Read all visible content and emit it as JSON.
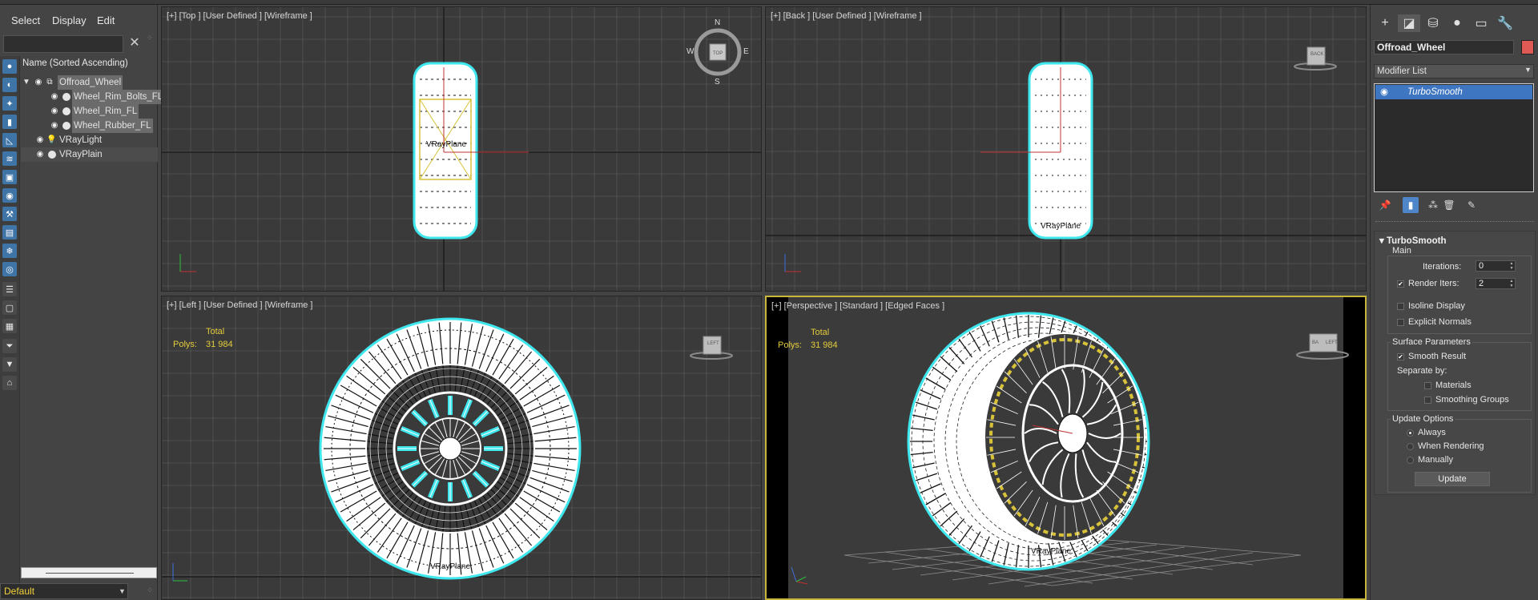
{
  "explorer": {
    "menu": [
      "Select",
      "Display",
      "Edit"
    ],
    "column_header": "Name (Sorted Ascending)",
    "objects": [
      {
        "name": "Offroad_Wheel",
        "selected": true
      },
      {
        "name": "Wheel_Rim_Bolts_FL",
        "selected": true
      },
      {
        "name": "Wheel_Rim_FL",
        "selected": true
      },
      {
        "name": "Wheel_Rubber_FL",
        "selected": true
      },
      {
        "name": "VRayLight",
        "selected": false
      },
      {
        "name": "VRayPlain",
        "selected": false
      }
    ],
    "layer": "Default"
  },
  "viewports": {
    "top": {
      "label": "[+] [Top ] [User Defined ] [Wireframe ]",
      "plane_label": "VRayPlane",
      "compass": {
        "n": "N",
        "s": "S",
        "e": "E",
        "w": "W"
      },
      "cube": "TOP"
    },
    "back": {
      "label": "[+] [Back ] [User Defined ] [Wireframe ]",
      "plane_label": "VRayPlane",
      "cube": "BACK"
    },
    "left": {
      "label": "[+] [Left ] [User Defined ] [Wireframe ]",
      "plane_label": "VRayPlane",
      "cube": "LEFT",
      "stats": {
        "total": "Total",
        "polys_label": "Polys:",
        "polys": "31 984"
      }
    },
    "perspective": {
      "label": "[+] [Perspective ] [Standard ] [Edged Faces ]",
      "plane_label": "VRayPlane",
      "cube_a": "BA",
      "cube_b": "LEFT",
      "stats": {
        "total": "Total",
        "polys_label": "Polys:",
        "polys": "31 984"
      }
    }
  },
  "command_panel": {
    "object_name": "Offroad_Wheel",
    "object_color": "#e05a55",
    "modifier_list": "Modifier List",
    "stack_item": "TurboSmooth",
    "rollout": {
      "title": "TurboSmooth",
      "main": "Main",
      "iterations_label": "Iterations:",
      "iterations": "0",
      "render_iters_label": "Render Iters:",
      "render_iters": "2",
      "isoline": "Isoline Display",
      "explicit": "Explicit Normals",
      "surface": "Surface Parameters",
      "smooth_result": "Smooth Result",
      "separate_by": "Separate by:",
      "materials": "Materials",
      "smoothing_groups": "Smoothing Groups",
      "update_options": "Update Options",
      "always": "Always",
      "when_rendering": "When Rendering",
      "manually": "Manually",
      "update": "Update"
    }
  },
  "colors": {
    "selection_cyan": "#3ee6ee",
    "active_border": "#c7b63b",
    "stats_yellow": "#e4cc3b",
    "gizmo_yellow": "#d8c23a"
  }
}
